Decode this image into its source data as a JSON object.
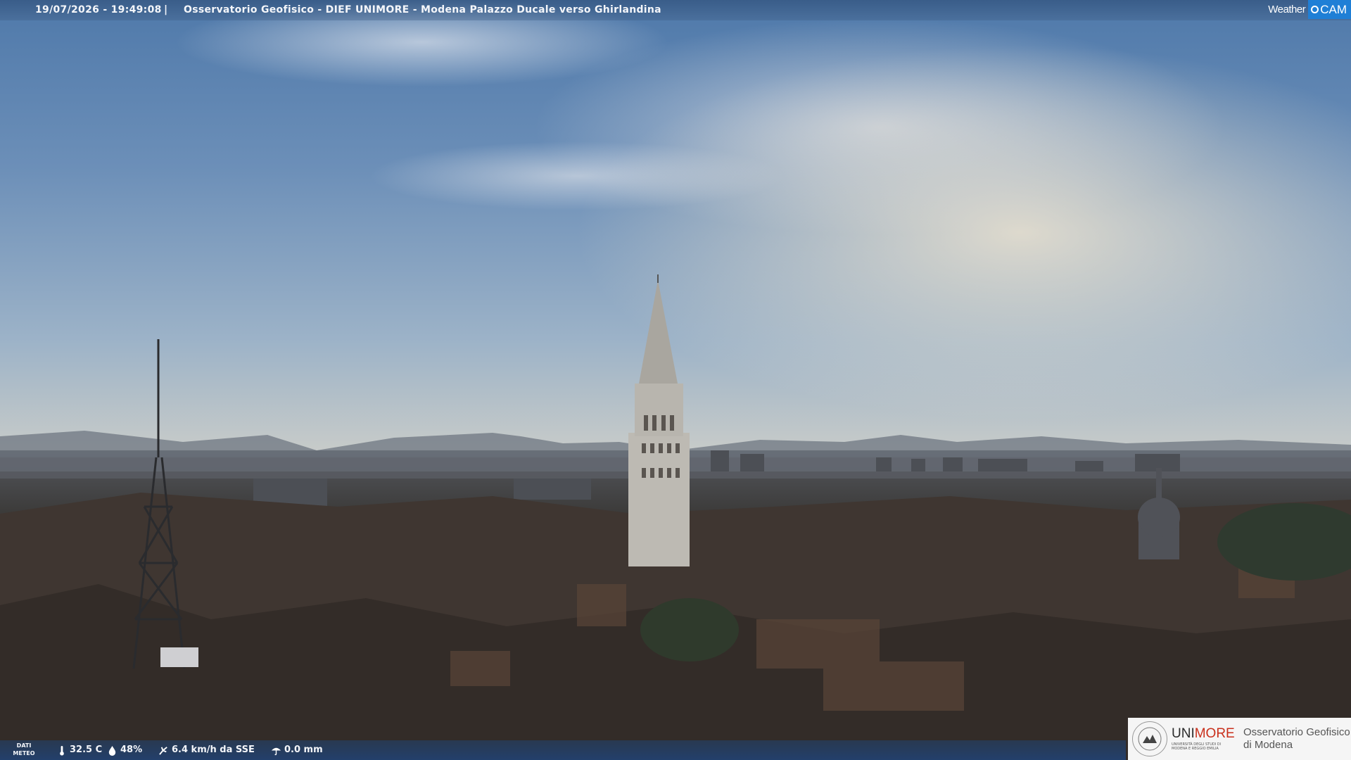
{
  "caption": {
    "datetime": "19/07/2026 - 19:49:08",
    "separator": "|",
    "title": "Osservatorio Geofisico - DIEF UNIMORE - Modena Palazzo Ducale verso Ghirlandina"
  },
  "brand": {
    "weather": "Weather",
    "cam": "CAM"
  },
  "weather_bar": {
    "dati_line1": "DATI",
    "dati_line2": "METEO",
    "temperature": "32.5 C",
    "humidity": "48%",
    "wind": "6.4 km/h da SSE",
    "rain": "0.0 mm",
    "icons": [
      "thermometer-icon",
      "humidity-drop-icon",
      "wind-icon",
      "rain-umbrella-icon"
    ]
  },
  "logo": {
    "uni_prefix": "UNI",
    "uni_suffix": "MORE",
    "uni_sub": "UNIVERSITÀ DEGLI STUDI DI MODENA E REGGIO EMILIA",
    "observatory_line1": "Osservatorio Geofisico",
    "observatory_line2": "di Modena"
  },
  "colors": {
    "accent": "#1f7fd6",
    "unimore_red": "#c9301c"
  }
}
